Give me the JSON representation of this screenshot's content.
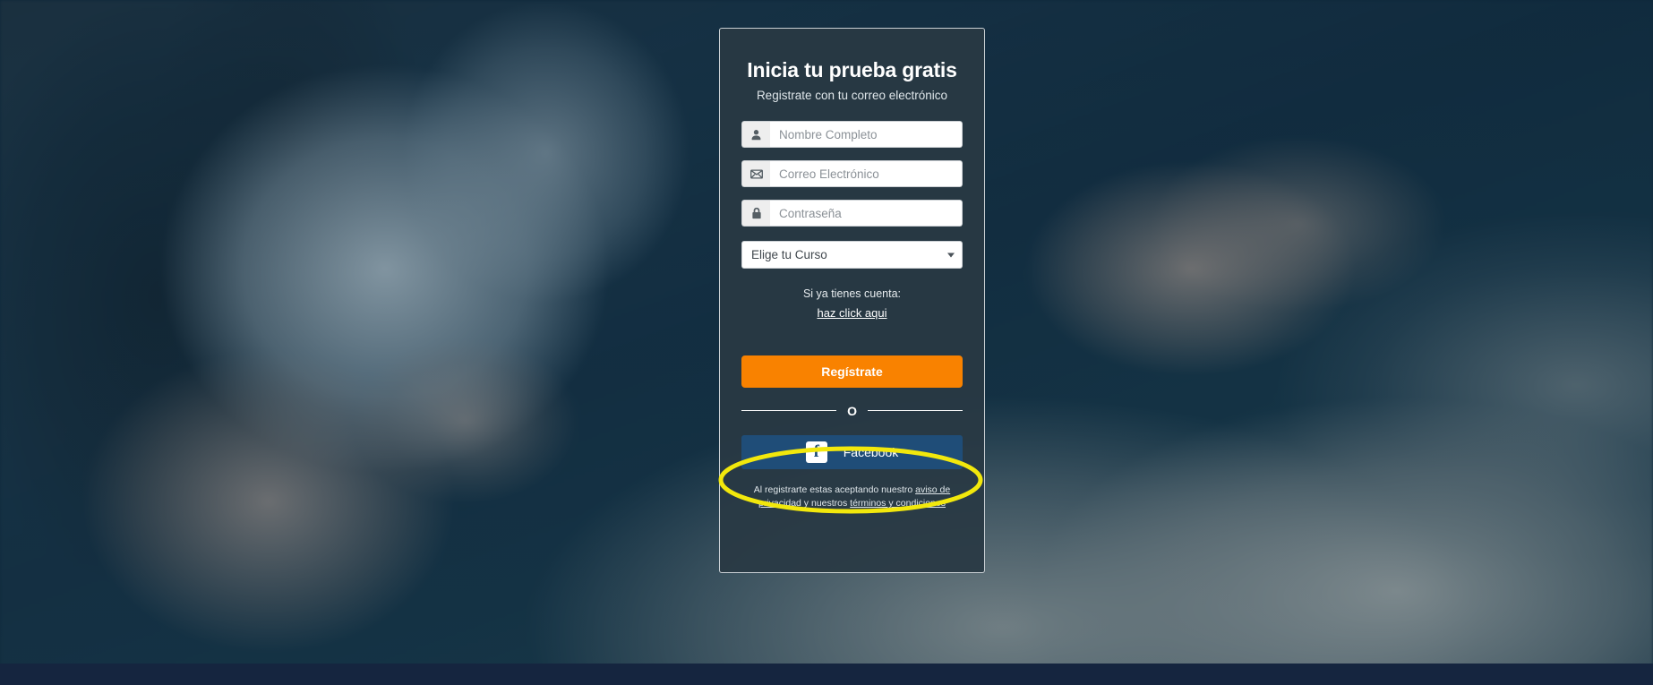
{
  "card": {
    "title": "Inicia tu prueba gratis",
    "subtitle": "Registrate con tu correo electrónico",
    "fields": [
      {
        "icon": "user-icon",
        "placeholder": "Nombre Completo",
        "value": ""
      },
      {
        "icon": "envelope-icon",
        "placeholder": "Correo Electrónico",
        "value": ""
      },
      {
        "icon": "lock-icon",
        "placeholder": "Contraseña",
        "value": ""
      }
    ],
    "course_select": {
      "selected": "Elige tu Curso",
      "caret_icon": "chevron-down-icon"
    },
    "account_prompt": "Si ya tienes cuenta:",
    "account_link": "haz click aqui",
    "register_label": "Regístrate",
    "divider_label": "O",
    "facebook": {
      "icon": "facebook-f-icon",
      "glyph": "f",
      "label": "Facebook"
    },
    "legal": {
      "lead": "Al registrarte estas aceptando nuestro ",
      "privacy_link": "aviso de privacidad",
      "middle": " y nuestros ",
      "terms_link": "términos y condiciones"
    }
  },
  "annotation": {
    "shape": "ellipse-highlight",
    "target": "facebook-button",
    "color": "#f2e80c"
  },
  "colors": {
    "card_bg": "#293944",
    "accent_orange": "#f98200",
    "facebook_blue": "#1f4d78",
    "footer_navy": "#15253f",
    "highlight_yellow": "#f2e80c"
  }
}
